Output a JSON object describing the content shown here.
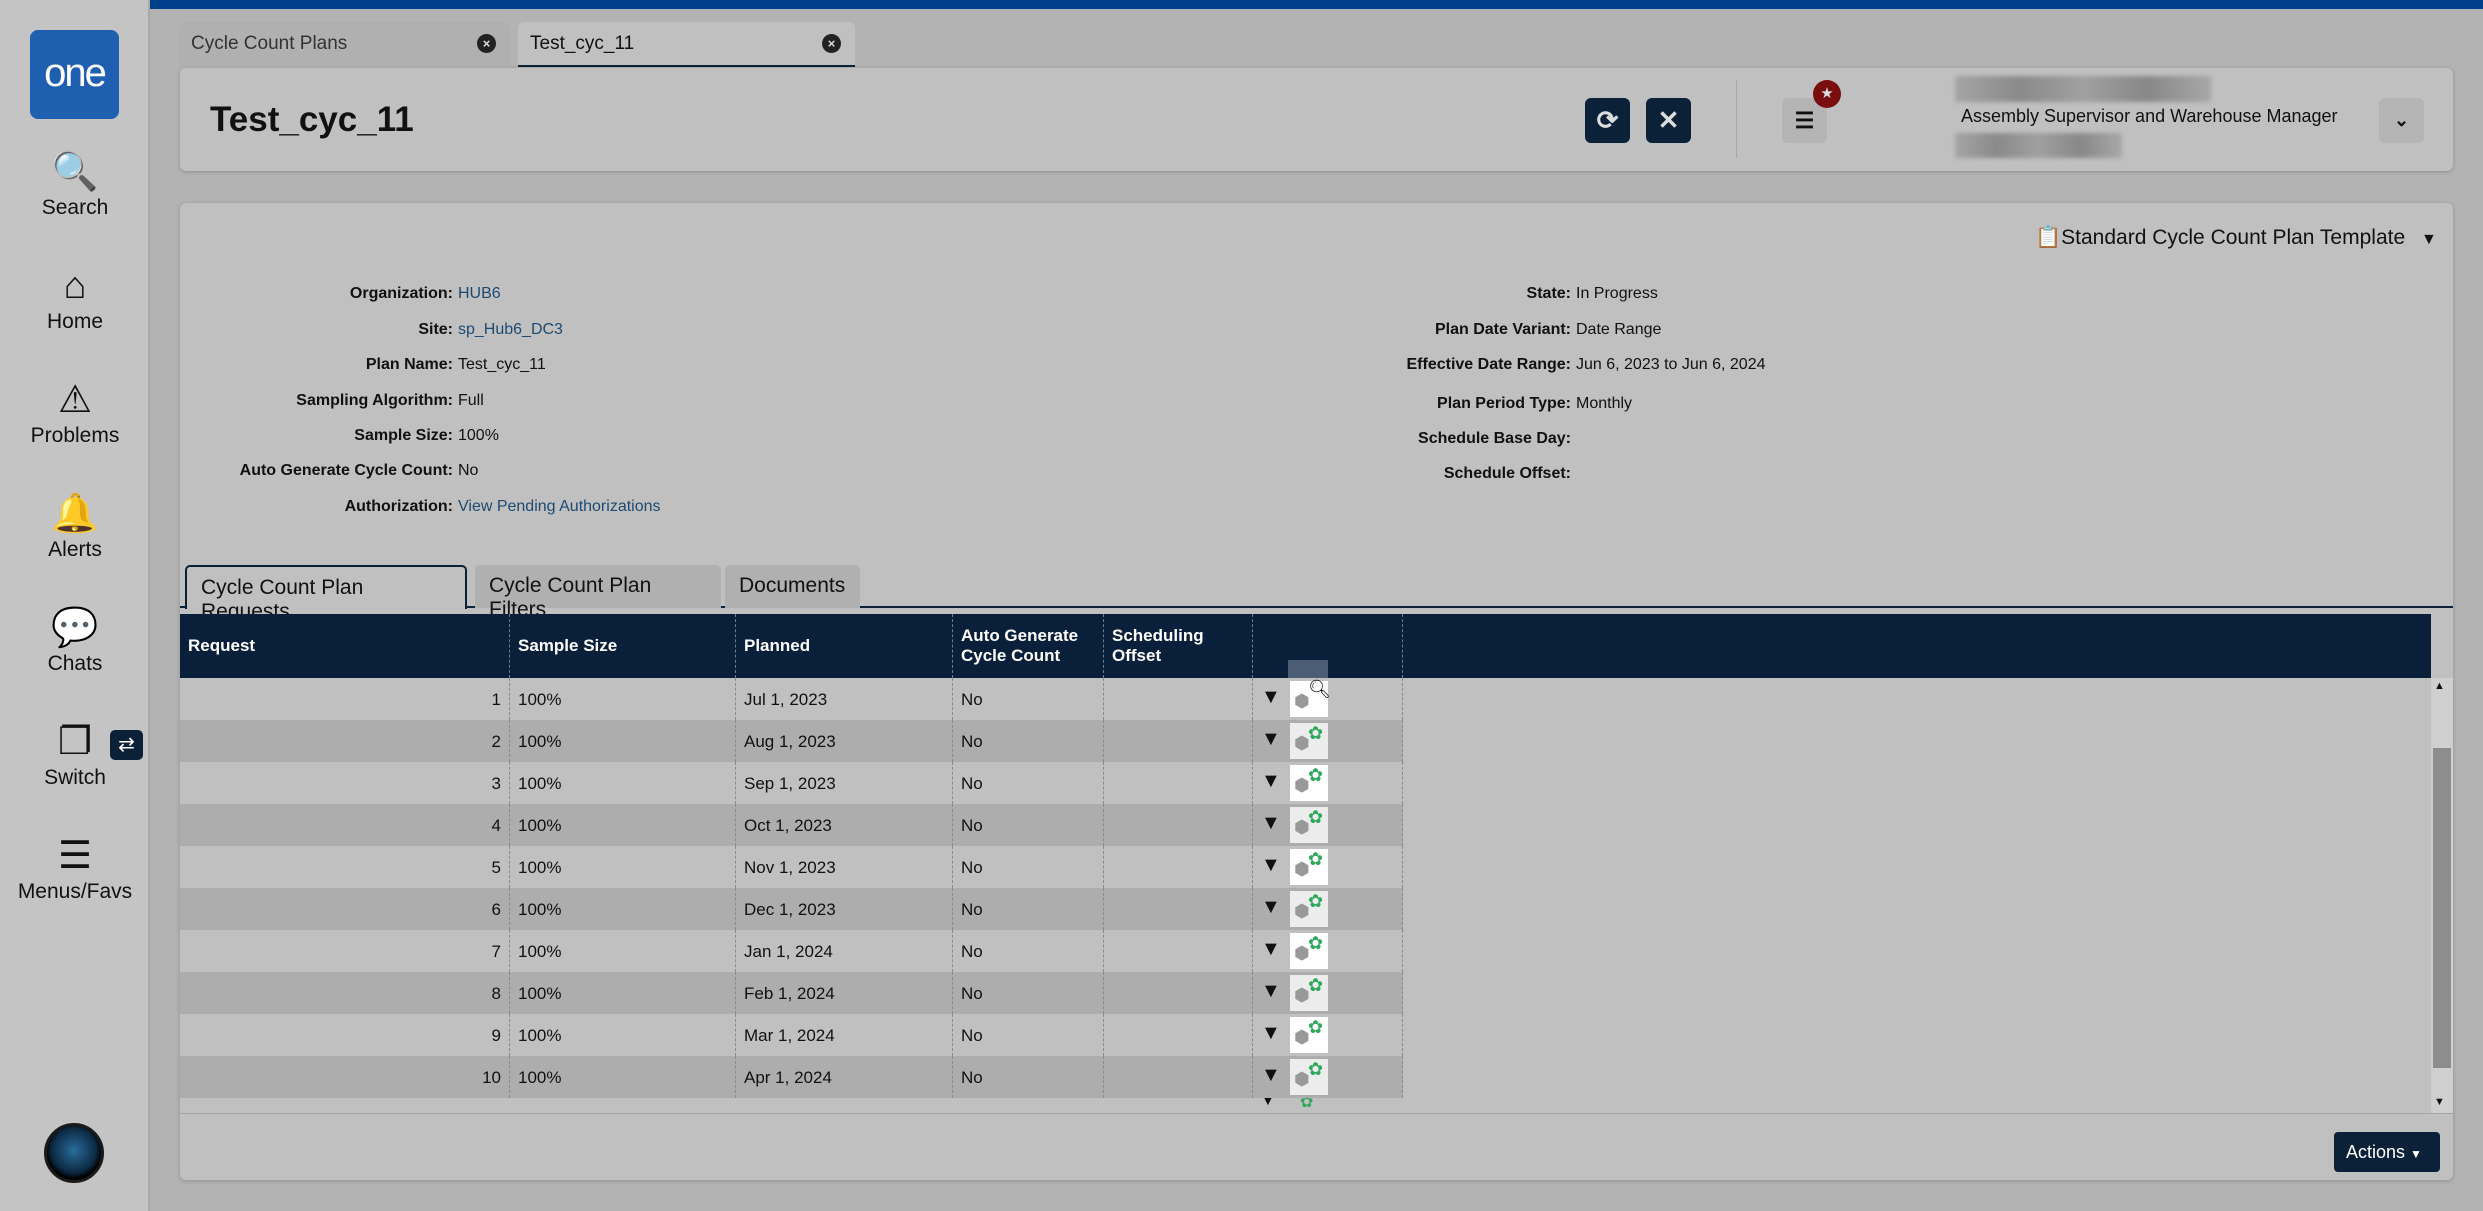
{
  "app": {
    "logo": "one"
  },
  "sidebar": {
    "items": [
      {
        "label": "Search",
        "icon": "search-icon",
        "glyph": "🔍"
      },
      {
        "label": "Home",
        "icon": "home-icon",
        "glyph": "⌂"
      },
      {
        "label": "Problems",
        "icon": "warning-icon",
        "glyph": "⚠"
      },
      {
        "label": "Alerts",
        "icon": "bell-icon",
        "glyph": "🔔"
      },
      {
        "label": "Chats",
        "icon": "chat-icon",
        "glyph": "💬"
      },
      {
        "label": "Switch",
        "icon": "switch-icon",
        "glyph": "❐"
      },
      {
        "label": "Menus/Favs",
        "icon": "menu-icon",
        "glyph": "☰"
      }
    ]
  },
  "tabs": [
    {
      "label": "Cycle Count Plans"
    },
    {
      "label": "Test_cyc_11"
    }
  ],
  "header": {
    "title": "Test_cyc_11",
    "user_role": "Assembly Supervisor and Warehouse Manager"
  },
  "template": {
    "label": "Standard Cycle Count Plan Template"
  },
  "fields_left": [
    {
      "label": "Organization:",
      "value": "HUB6",
      "link": true
    },
    {
      "label": "Site:",
      "value": "sp_Hub6_DC3",
      "link": true
    },
    {
      "label": "Plan Name:",
      "value": "Test_cyc_11"
    },
    {
      "label": "Sampling Algorithm:",
      "value": "Full"
    },
    {
      "label": "Sample Size:",
      "value": "100%"
    },
    {
      "label": "Auto Generate Cycle Count:",
      "value": "No"
    },
    {
      "label": "Authorization:",
      "value": "View Pending Authorizations",
      "link": true
    }
  ],
  "fields_right": [
    {
      "label": "State:",
      "value": "In Progress"
    },
    {
      "label": "Plan Date Variant:",
      "value": "Date Range"
    },
    {
      "label": "Effective Date Range:",
      "value": "Jun 6, 2023 to Jun 6, 2024"
    },
    {
      "label": "Plan Period Type:",
      "value": "Monthly"
    },
    {
      "label": "Schedule Base Day:",
      "value": ""
    },
    {
      "label": "Schedule Offset:",
      "value": ""
    }
  ],
  "panel_tabs": [
    {
      "label": "Cycle Count Plan Requests"
    },
    {
      "label": "Cycle Count Plan Filters"
    },
    {
      "label": "Documents"
    }
  ],
  "table": {
    "columns": [
      "Request",
      "Sample Size",
      "Planned",
      "Auto Generate Cycle Count",
      "Scheduling Offset",
      ""
    ],
    "rows": [
      [
        "1",
        "100%",
        "Jul 1, 2023",
        "No",
        ""
      ],
      [
        "2",
        "100%",
        "Aug 1, 2023",
        "No",
        ""
      ],
      [
        "3",
        "100%",
        "Sep 1, 2023",
        "No",
        ""
      ],
      [
        "4",
        "100%",
        "Oct 1, 2023",
        "No",
        ""
      ],
      [
        "5",
        "100%",
        "Nov 1, 2023",
        "No",
        ""
      ],
      [
        "6",
        "100%",
        "Dec 1, 2023",
        "No",
        ""
      ],
      [
        "7",
        "100%",
        "Jan 1, 2024",
        "No",
        ""
      ],
      [
        "8",
        "100%",
        "Feb 1, 2024",
        "No",
        ""
      ],
      [
        "9",
        "100%",
        "Mar 1, 2024",
        "No",
        ""
      ],
      [
        "10",
        "100%",
        "Apr 1, 2024",
        "No",
        ""
      ]
    ]
  },
  "footer": {
    "actions_label": "Actions"
  },
  "colors": {
    "brand": "#003f8a",
    "navy": "#0a1f3a",
    "gear": "#2eaa5c",
    "badge": "#7a0d0d"
  }
}
